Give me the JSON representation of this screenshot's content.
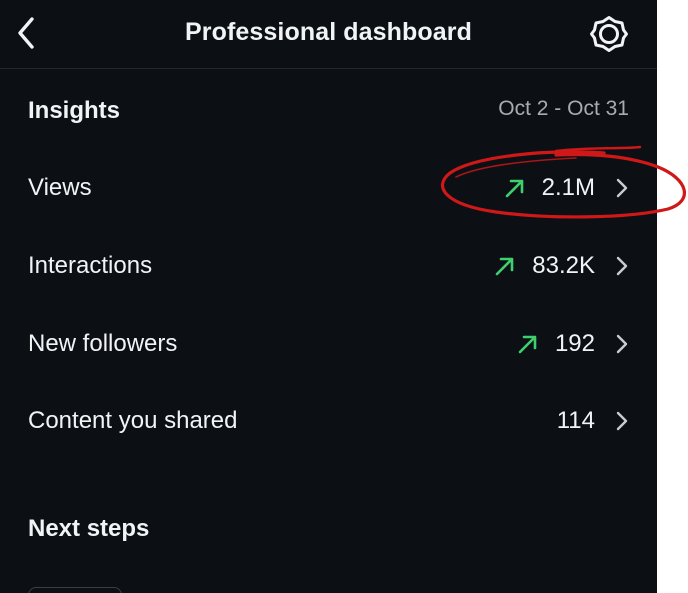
{
  "header": {
    "title": "Professional dashboard",
    "back_icon": "chevron-left-icon",
    "settings_icon": "gear-icon"
  },
  "insights": {
    "title": "Insights",
    "date_range": "Oct 2 - Oct 31",
    "rows": [
      {
        "label": "Views",
        "value": "2.1M",
        "trend": "up"
      },
      {
        "label": "Interactions",
        "value": "83.2K",
        "trend": "up"
      },
      {
        "label": "New followers",
        "value": "192",
        "trend": "up"
      },
      {
        "label": "Content you shared",
        "value": "114",
        "trend": null
      }
    ]
  },
  "next_steps": {
    "title": "Next steps"
  },
  "colors": {
    "background": "#0c1015",
    "text": "#f2f3f5",
    "muted": "#a7acb3",
    "trend_up": "#3fcf6d",
    "annotation": "#d01818"
  }
}
